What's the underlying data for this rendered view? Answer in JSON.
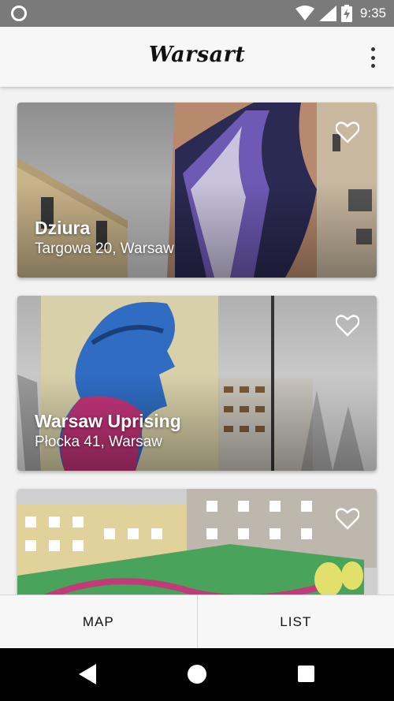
{
  "status_bar": {
    "time": "9:35",
    "icons": [
      "circle-notification-icon",
      "wifi-icon",
      "signal-icon",
      "battery-charging-icon"
    ]
  },
  "app_bar": {
    "title": "Warsart",
    "menu_icon": "more-vert-icon"
  },
  "cards": [
    {
      "title": "Dziura",
      "address": "Targowa 20, Warsaw",
      "favorite_icon": "heart-outline-icon",
      "favorited": false
    },
    {
      "title": "Warsaw Uprising",
      "address": "Płocka 41, Warsaw",
      "favorite_icon": "heart-outline-icon",
      "favorited": false
    },
    {
      "title": "",
      "address": "",
      "favorite_icon": "heart-outline-icon",
      "favorited": false
    }
  ],
  "bottom_nav": {
    "tabs": [
      {
        "label": "MAP"
      },
      {
        "label": "LIST"
      }
    ]
  },
  "system_nav": {
    "buttons": [
      "back-icon",
      "home-icon",
      "recents-icon"
    ]
  }
}
